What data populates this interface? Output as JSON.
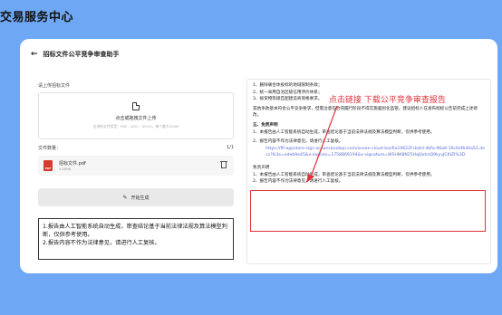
{
  "site": {
    "title": "交易服务中心"
  },
  "page": {
    "title": "招标文件公平竞争审查助手"
  },
  "left": {
    "upload_label": "请上传招标文件",
    "upload_main": "点击或拖拽文件上传",
    "upload_hint": "支持的文件类型：PDF、DOC、DOCX，每个最大100M",
    "file_count_label": "文件数量：",
    "file_count": "1/1",
    "file_name": "招标文件.pdf",
    "file_size": "4.68MB",
    "generate_label": "开始生成",
    "disclaimer_1": "1.报告由人工智能系统自动生成，审查结论基于当前法律法规及算法模型判断，仅供参考使用。",
    "disclaimer_2": "2.报告内容不作为法律意见，请进行人工复核。"
  },
  "report": {
    "items_top": [
      "1、删除联合体投标的地域限制条款；",
      "2、统一采用自治区级信用评价体系；",
      "3、按货物等级匹配建造商资格要求。"
    ],
    "summary": "其他条款基本符合公平竞争要求，但需注意在合同履行阶段不得实施差别化监管。建议招标人在发布招标公告前完成上述修改。",
    "section_five": "五、免责声明",
    "disclaimer_items": [
      "1、本报告由人工智能系统自动生成，审查结论基于当前法律法规及算法模型判断，仅供参考使用。",
      "2、报告内容不作为法律意见，请进行人工复核。"
    ],
    "link": "https://ffl-appstore-sign.oceancloudapi.com/ocean-cloud-tos/6a19622f-da4d-4bfa-96a8-16c6ef644a53.docx?lk3s=edeb9e45&x-expires=1758869194&x-signature=WSHW8N25HqQetrzQ9kyvJCKIZI%3D",
    "section_disclaimer": "免责声明",
    "bottom_items": [
      "1、本报告由人工智能系统自动生成，审查结论基于当前法律法规及算法模型判断，仅供参考使用。",
      "2、报告内容不作为法律意见，请进行人工复核。"
    ]
  },
  "annotation": {
    "text": "点击链接 下载公平竞争审查报告",
    "color": "#e0333b"
  }
}
